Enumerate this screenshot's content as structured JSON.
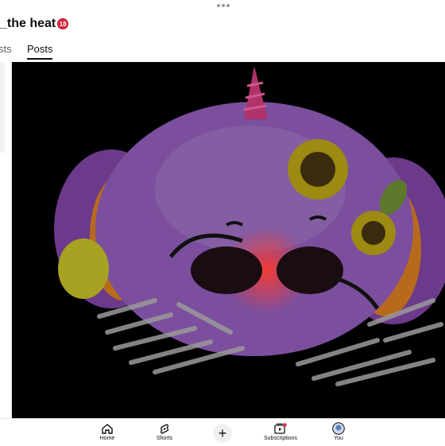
{
  "channel": {
    "name": "_the heat",
    "age_badge": "18"
  },
  "tabs": [
    {
      "label": "sts"
    },
    {
      "label": "Posts",
      "selected": true
    }
  ],
  "post": {
    "image_icon": "unicorn-with-sunflowers-drawing"
  },
  "bottom_nav": {
    "items": [
      {
        "label": "Home",
        "icon": "home-icon"
      },
      {
        "label": "Shorts",
        "icon": "shorts-icon"
      },
      {
        "label": "",
        "icon": "plus-icon"
      },
      {
        "label": "Subscriptions",
        "icon": "subscriptions-icon"
      },
      {
        "label": "You",
        "icon": "avatar-icon"
      }
    ]
  },
  "colors": {
    "badge_red": "#e0243c",
    "notification_dot": "#e0243c",
    "text_primary": "#0f0f0f",
    "text_secondary": "#606060"
  }
}
